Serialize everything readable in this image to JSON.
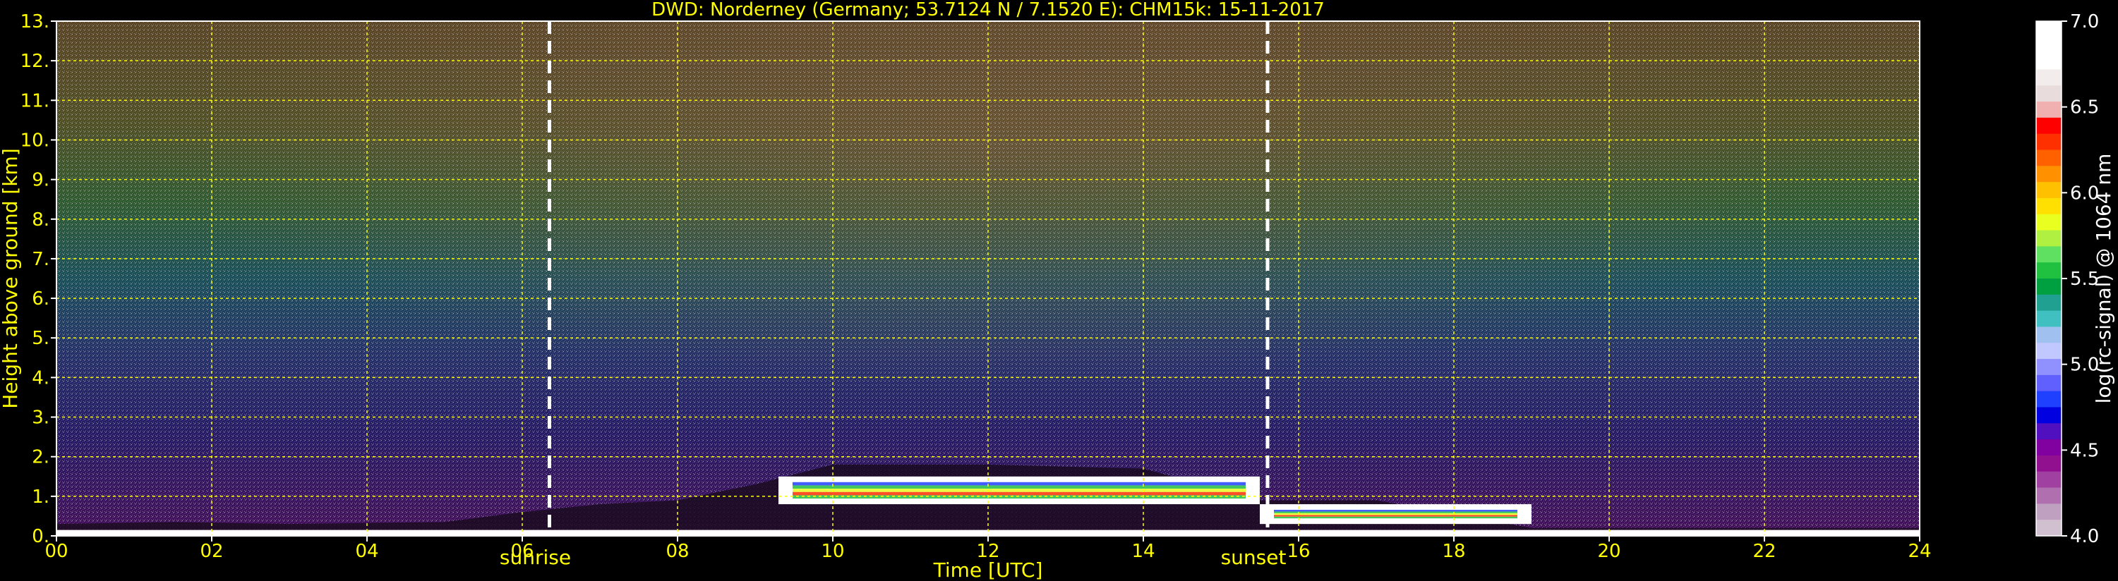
{
  "chart_data": {
    "type": "heatmap",
    "title": "DWD: Norderney (Germany; 53.7124 N / 7.1520 E):    CHM15k: 15-11-2017",
    "xlabel": "Time [UTC]",
    "ylabel": "Height above ground [km]",
    "xlim": [
      0,
      24
    ],
    "ylim": [
      0,
      13
    ],
    "x_ticks": [
      "00",
      "02",
      "04",
      "06",
      "08",
      "10",
      "12",
      "14",
      "16",
      "18",
      "20",
      "22",
      "24"
    ],
    "y_ticks": [
      "0.",
      "1.",
      "2.",
      "3.",
      "4.",
      "5.",
      "6.",
      "7.",
      "8.",
      "9.",
      "10.",
      "11.",
      "12.",
      "13."
    ],
    "grid": true,
    "annotations": [
      {
        "label": "sunrise",
        "x": 6.35
      },
      {
        "label": "sunset",
        "x": 15.6
      }
    ],
    "colorbar": {
      "label": "log(rc-signal) @ 1064 nm",
      "ticks": [
        "4.0",
        "4.5",
        "5.0",
        "5.5",
        "6.0",
        "6.5",
        "7.0"
      ],
      "range": [
        4.0,
        7.0
      ],
      "colors": [
        "#ffffff",
        "#ffffff",
        "#ffffff",
        "#f3ecec",
        "#e8dcdc",
        "#f0b0b0",
        "#ff0000",
        "#ff3000",
        "#ff6000",
        "#ff9000",
        "#ffc000",
        "#ffe000",
        "#e8ff20",
        "#b0f040",
        "#60e060",
        "#20c040",
        "#00a040",
        "#20a090",
        "#40c0c0",
        "#a0c0f0",
        "#c0c8ff",
        "#9090ff",
        "#6060ff",
        "#2040ff",
        "#0000e0",
        "#5010c0",
        "#8000a0",
        "#901090",
        "#a040a0",
        "#b070b0",
        "#c0a0c0",
        "#d0c0d0"
      ]
    },
    "cloud_layers": [
      {
        "from": 9.3,
        "to": 15.5,
        "base_km": 0.8,
        "top_km": 1.5
      },
      {
        "from": 15.5,
        "to": 19.0,
        "base_km": 0.3,
        "top_km": 0.8
      }
    ],
    "boundary_layer_top_km": [
      [
        0,
        0.3
      ],
      [
        1.5,
        0.35
      ],
      [
        3,
        0.3
      ],
      [
        5,
        0.35
      ],
      [
        6,
        0.6
      ],
      [
        7,
        0.8
      ],
      [
        8,
        0.9
      ],
      [
        9,
        1.3
      ],
      [
        10,
        1.8
      ],
      [
        12,
        1.8
      ],
      [
        14,
        1.7
      ],
      [
        15.5,
        0.9
      ],
      [
        17,
        0.9
      ],
      [
        19,
        0.2
      ],
      [
        24,
        0.2
      ]
    ]
  }
}
